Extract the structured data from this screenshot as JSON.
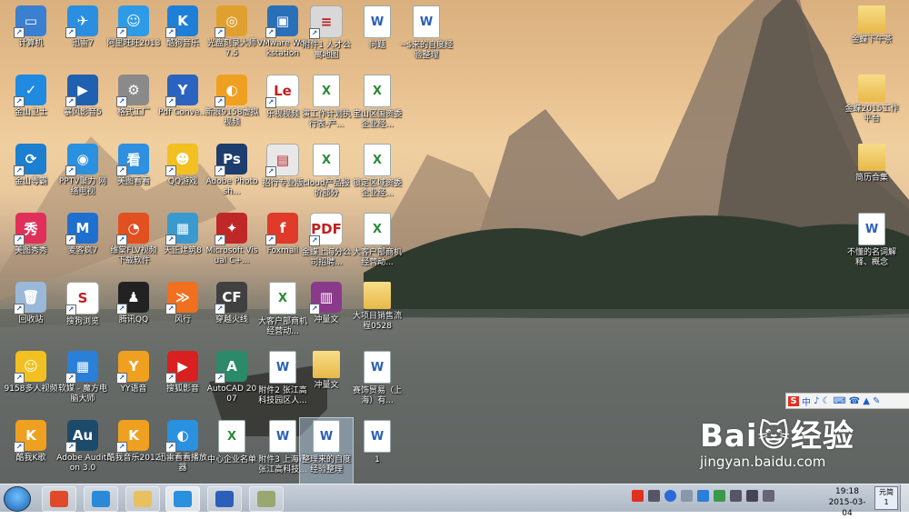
{
  "desktop_icons": [
    {
      "label": "计算机",
      "kind": "app",
      "color": "#3a7fd0",
      "glyph": "▭"
    },
    {
      "label": "迅雷7",
      "kind": "app",
      "color": "#2a8fe0",
      "glyph": "✈"
    },
    {
      "label": "阿里旺旺2013",
      "kind": "app",
      "color": "#2e9be6",
      "glyph": "☺"
    },
    {
      "label": "酷狗音乐",
      "kind": "app",
      "color": "#1e7fd8",
      "glyph": "K"
    },
    {
      "label": "光盘刻录大师 7.5",
      "kind": "app",
      "color": "#e0a030",
      "glyph": "◎"
    },
    {
      "label": "VMware Workstation",
      "kind": "app",
      "color": "#2a70b8",
      "glyph": "▣"
    },
    {
      "label": "附件1 人才公寓地图",
      "kind": "app",
      "color": "#d8d8d8",
      "glyph": "≡"
    },
    {
      "label": "问题",
      "kind": "doc",
      "color": "#ffffff",
      "glyph": "W"
    },
    {
      "label": "~$来的自度经验整理",
      "kind": "doc",
      "color": "#ffffff",
      "glyph": "W"
    },
    {
      "label": "金山卫士",
      "kind": "app",
      "color": "#1f8ae0",
      "glyph": "✓"
    },
    {
      "label": "暴风影音5",
      "kind": "app",
      "color": "#2060b0",
      "glyph": "▶"
    },
    {
      "label": "格式工厂",
      "kind": "app",
      "color": "#8a8a8a",
      "glyph": "⚙"
    },
    {
      "label": "Pdf Conve...",
      "kind": "app",
      "color": "#2a64c0",
      "glyph": "Y"
    },
    {
      "label": "新浪9158虚拟视频",
      "kind": "app",
      "color": "#f0a020",
      "glyph": "◐"
    },
    {
      "label": "乐视视频",
      "kind": "app",
      "color": "#ffffff",
      "glyph": "Le"
    },
    {
      "label": "演工作计划执行表-产...",
      "kind": "xls",
      "color": "#ffffff",
      "glyph": "X"
    },
    {
      "label": "宝山区国资委企业经...",
      "kind": "xls",
      "color": "#ffffff",
      "glyph": "X"
    },
    {
      "label": "金山毒霸",
      "kind": "app",
      "color": "#1c7fd0",
      "glyph": "⟳"
    },
    {
      "label": "PPTV聚力 网络电视",
      "kind": "app",
      "color": "#2a90e0",
      "glyph": "◉"
    },
    {
      "label": "美图看看",
      "kind": "app",
      "color": "#2f8fe0",
      "glyph": "看"
    },
    {
      "label": "QQ游戏",
      "kind": "app",
      "color": "#f2c020",
      "glyph": "☻"
    },
    {
      "label": "Adobe Photosh...",
      "kind": "app",
      "color": "#1c3d6e",
      "glyph": "Ps"
    },
    {
      "label": "招行专业版",
      "kind": "app",
      "color": "#e8e8e8",
      "glyph": "▤"
    },
    {
      "label": "cloud产品报价部分",
      "kind": "xls",
      "color": "#ffffff",
      "glyph": "X"
    },
    {
      "label": "锁定区域资委企业经...",
      "kind": "xls",
      "color": "#ffffff",
      "glyph": "X"
    },
    {
      "label": "美图秀秀",
      "kind": "app",
      "color": "#e0305a",
      "glyph": "秀"
    },
    {
      "label": "麦客疯7",
      "kind": "app",
      "color": "#1e6fd0",
      "glyph": "M"
    },
    {
      "label": "维棠FLV视频下载软件",
      "kind": "app",
      "color": "#e05020",
      "glyph": "◔"
    },
    {
      "label": "天正建筑8",
      "kind": "app",
      "color": "#3a9ad0",
      "glyph": "▦"
    },
    {
      "label": "Microsoft Visual C+...",
      "kind": "app",
      "color": "#c02828",
      "glyph": "✦"
    },
    {
      "label": "Foxmail",
      "kind": "app",
      "color": "#e03a2a",
      "glyph": "f"
    },
    {
      "label": "金蝶上海分公司招聘...",
      "kind": "app",
      "color": "#ffffff",
      "glyph": "PDF"
    },
    {
      "label": "大客户部商机经营动...",
      "kind": "xls",
      "color": "#ffffff",
      "glyph": "X"
    },
    {
      "label": "回收站",
      "kind": "app",
      "color": "#9ab8d8",
      "glyph": "🗑"
    },
    {
      "label": "搜狗浏览",
      "kind": "app",
      "color": "#ffffff",
      "glyph": "S"
    },
    {
      "label": "腾讯QQ",
      "kind": "app",
      "color": "#222222",
      "glyph": "♟"
    },
    {
      "label": "风行",
      "kind": "app",
      "color": "#f07020",
      "glyph": "≫"
    },
    {
      "label": "穿越火线",
      "kind": "app",
      "color": "#404040",
      "glyph": "CF"
    },
    {
      "label": "大客户部商机经营动...",
      "kind": "xls",
      "color": "#ffffff",
      "glyph": "X"
    },
    {
      "label": "冲量文",
      "kind": "app",
      "color": "#8a3a8a",
      "glyph": "▥"
    },
    {
      "label": "大项目销售流程0528",
      "kind": "folder",
      "color": "#f0c860",
      "glyph": ""
    },
    {
      "label": "9158多人视频",
      "kind": "app",
      "color": "#f2c020",
      "glyph": "☺"
    },
    {
      "label": "软媒 - 魔方电脑大师",
      "kind": "app",
      "color": "#2a7fd8",
      "glyph": "▦"
    },
    {
      "label": "YY语音",
      "kind": "app",
      "color": "#f0a020",
      "glyph": "Y"
    },
    {
      "label": "搜狐影音",
      "kind": "app",
      "color": "#d82020",
      "glyph": "▶"
    },
    {
      "label": "AutoCAD 2007",
      "kind": "app",
      "color": "#2a8a6a",
      "glyph": "A"
    },
    {
      "label": "附件2 张江高科技园区人...",
      "kind": "doc",
      "color": "#ffffff",
      "glyph": "W"
    },
    {
      "label": "冲量文",
      "kind": "folder",
      "color": "#f0c860",
      "glyph": ""
    },
    {
      "label": "赛饰贸易（上海）有...",
      "kind": "doc",
      "color": "#ffffff",
      "glyph": "W"
    },
    {
      "label": "酷我K歌",
      "kind": "app",
      "color": "#f0a020",
      "glyph": "K"
    },
    {
      "label": "Adobe Audition 3.0",
      "kind": "app",
      "color": "#1c4a6a",
      "glyph": "Au"
    },
    {
      "label": "酷我音乐2012",
      "kind": "app",
      "color": "#f0a020",
      "glyph": "K"
    },
    {
      "label": "迅雷看看播放器",
      "kind": "app",
      "color": "#2a90e0",
      "glyph": "◐"
    },
    {
      "label": "中心企业名单",
      "kind": "xls",
      "color": "#ffffff",
      "glyph": "X"
    },
    {
      "label": "附件3 上海市张江高科技...",
      "kind": "doc",
      "color": "#ffffff",
      "glyph": "W"
    },
    {
      "label": "整理来的自度经验整理",
      "kind": "doc",
      "color": "#ffffff",
      "glyph": "W"
    },
    {
      "label": "1",
      "kind": "doc",
      "color": "#ffffff",
      "glyph": "W"
    },
    {
      "label": "金蝶下午茶",
      "kind": "folder",
      "color": "#f0c860",
      "glyph": ""
    },
    {
      "label": "金蝶2015工作平台",
      "kind": "folder",
      "color": "#f0c860",
      "glyph": ""
    },
    {
      "label": "简历合集",
      "kind": "folder",
      "color": "#f0c860",
      "glyph": ""
    },
    {
      "label": "不懂的名词解释、概念",
      "kind": "doc",
      "color": "#ffffff",
      "glyph": "W"
    }
  ],
  "ime_bar": {
    "mode": "中",
    "items": [
      "S",
      "中",
      "♪",
      "☾",
      "⌨",
      "☎",
      "👕",
      "🔧"
    ]
  },
  "watermark": {
    "brand": "Bai😺经验",
    "url": "jingyan.baidu.com"
  },
  "taskbar": {
    "clock_time": "19:18",
    "clock_date": "2015-03-04",
    "lang": "元简",
    "lang_sub": "1",
    "pinned": [
      {
        "name": "chrome-taskbar-button",
        "color": "#e04a2a"
      },
      {
        "name": "ie-taskbar-button",
        "color": "#2a8ad8"
      },
      {
        "name": "explorer-taskbar-button",
        "color": "#e8c060"
      },
      {
        "name": "xunlei-taskbar-button",
        "color": "#2a90e0"
      },
      {
        "name": "word-taskbar-button",
        "color": "#2b5fb8"
      },
      {
        "name": "image-viewer-taskbar-button",
        "color": "#9aa870"
      }
    ]
  }
}
